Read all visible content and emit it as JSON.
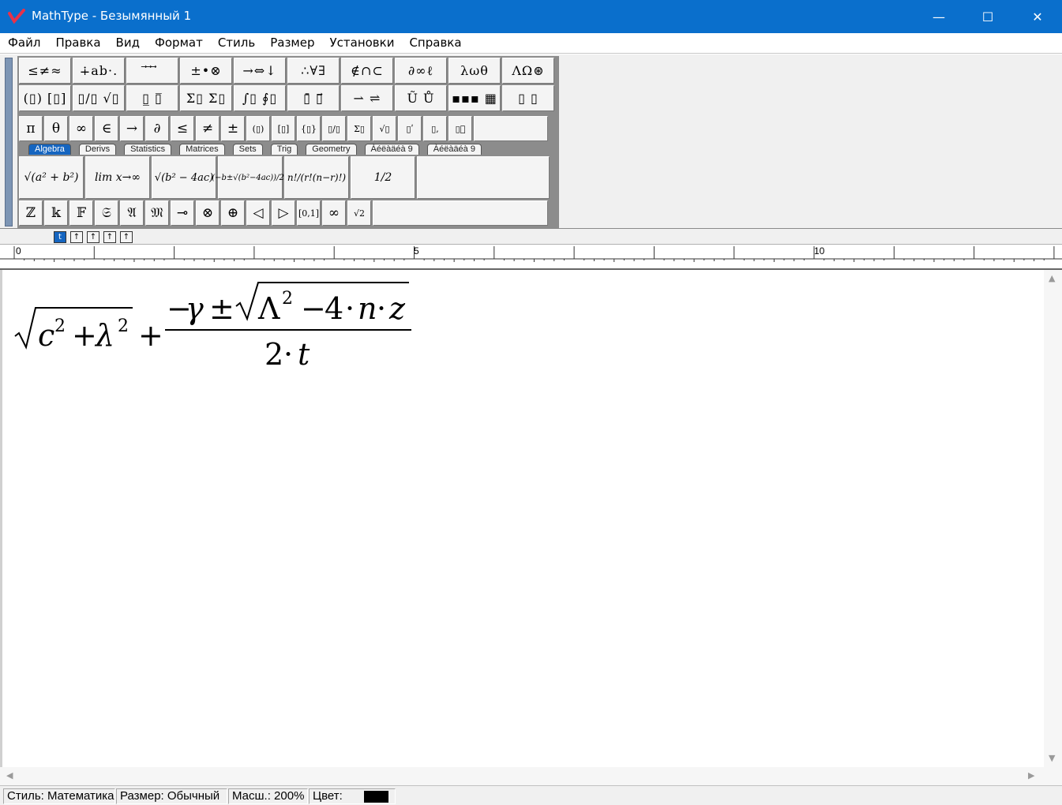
{
  "window": {
    "title": "MathType - Безымянный 1",
    "minimize": "—",
    "maximize": "☐",
    "close": "✕"
  },
  "menu": [
    "Файл",
    "Правка",
    "Вид",
    "Формат",
    "Стиль",
    "Размер",
    "Установки",
    "Справка"
  ],
  "palettes_row1": [
    "≤≠≈",
    "∔ab·.",
    "⃗ ⃗ ⃗",
    "±•⊗",
    "→⇔↓",
    "∴∀∃",
    "∉∩⊂",
    "∂∞ℓ",
    "λωθ",
    "ΛΩ⊛"
  ],
  "palettes_row2": [
    "(▯) [▯]",
    "▯/▯ √▯",
    "▯̲ ▯̅",
    "Σ▯ Σ▯",
    "∫▯ ∮▯",
    "▯̄ ▯⃗",
    "⇀ ⇌",
    "Ũ Ů",
    "▪▪▪ ▦",
    "▯ ▯"
  ],
  "symbols_row": [
    "π",
    "θ",
    "∞",
    "∈",
    "→",
    "∂",
    "≤",
    "≠",
    "±",
    "(▯)",
    "[▯]",
    "{▯}",
    "▯/▯",
    "Σ▯",
    "√▯",
    "▯ʹ",
    "▯,",
    "▯ͦ"
  ],
  "tabs": [
    "Algebra",
    "Derivs",
    "Statistics",
    "Matrices",
    "Sets",
    "Trig",
    "Geometry",
    "Àéëàäéà 9",
    "Àéëàäéà 9"
  ],
  "active_tab": "Algebra",
  "expressions": [
    "√(a² + b²)",
    "lim x→∞",
    "√(b² − 4ac)",
    "(−b±√(b²−4ac))/2a",
    "n!/(r!(n−r)!)",
    "1/2"
  ],
  "bottom_row": [
    "ℤ",
    "𝕜",
    "𝔽",
    "𝔖",
    "𝔄",
    "𝔐",
    "⊸",
    "⊗",
    "⊕",
    "◁",
    "▷",
    "[0,1]",
    "∞",
    "√2"
  ],
  "nudge_buttons": [
    "t",
    "↑",
    "↑",
    "↑",
    "↑"
  ],
  "ruler": {
    "labels": [
      "0",
      "5",
      "10"
    ]
  },
  "status": {
    "style": "Стиль: Математика",
    "size": "Размер: Обычный",
    "zoom": "Масш.: 200%",
    "color_label": "Цвет:",
    "color_value": "#000000"
  },
  "accent_color": "#0a6fcc"
}
